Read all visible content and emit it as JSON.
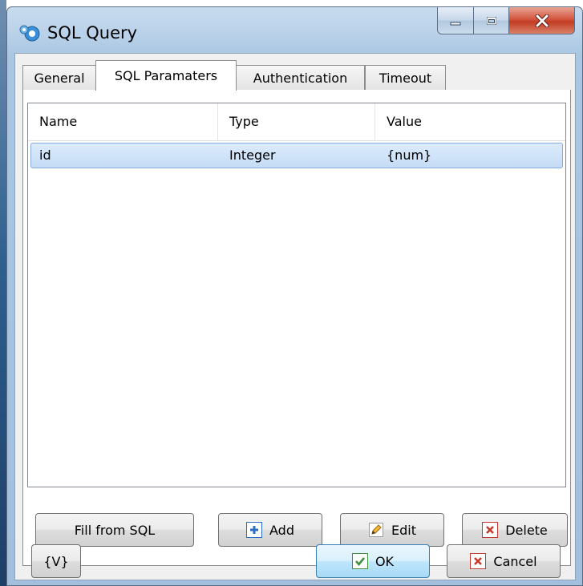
{
  "window": {
    "title": "SQL Query"
  },
  "tabs": [
    {
      "label": "General",
      "active": false
    },
    {
      "label": "SQL Paramaters",
      "active": true
    },
    {
      "label": "Authentication",
      "active": false
    },
    {
      "label": "Timeout",
      "active": false
    }
  ],
  "params_table": {
    "columns": [
      "Name",
      "Type",
      "Value"
    ],
    "rows": [
      {
        "name": "id",
        "type": "Integer",
        "value": "{num}",
        "selected": true
      }
    ]
  },
  "actions": {
    "fill_label": "Fill from SQL",
    "add_label": "Add",
    "edit_label": "Edit",
    "delete_label": "Delete"
  },
  "footer": {
    "variables_label": "{V}",
    "ok_label": "OK",
    "cancel_label": "Cancel"
  },
  "icons": {
    "app": "sql-query-app-icon",
    "add": "plus-icon",
    "edit": "pencil-icon",
    "delete": "x-icon",
    "ok": "check-icon",
    "cancel": "x-icon"
  },
  "colors": {
    "frame": "#b6cfe8",
    "close_button": "#c9462e",
    "selection": "#cfe3f9",
    "add_icon": "#2b6fc5",
    "delete_icon": "#c4392f",
    "ok_icon": "#3f8f3f"
  }
}
